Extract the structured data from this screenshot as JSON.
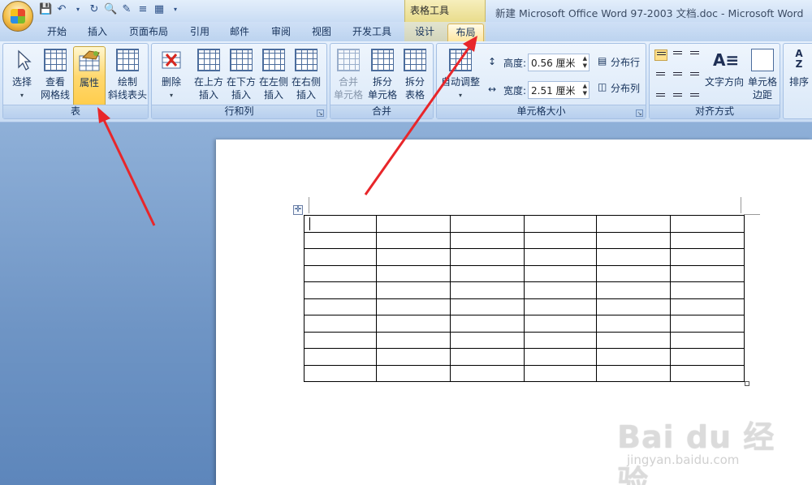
{
  "window": {
    "title": "新建 Microsoft Office Word 97-2003 文档.doc - Microsoft Word",
    "context_group": "表格工具"
  },
  "tabs": [
    {
      "label": "开始"
    },
    {
      "label": "插入"
    },
    {
      "label": "页面布局"
    },
    {
      "label": "引用"
    },
    {
      "label": "邮件"
    },
    {
      "label": "审阅"
    },
    {
      "label": "视图"
    },
    {
      "label": "开发工具"
    },
    {
      "label": "设计"
    },
    {
      "label": "布局",
      "active": true
    }
  ],
  "ribbon": {
    "groups": {
      "table": {
        "label": "表",
        "select": "选择",
        "view_gridlines_1": "查看",
        "view_gridlines_2": "网格线",
        "properties": "属性",
        "draw_diag_1": "绘制",
        "draw_diag_2": "斜线表头"
      },
      "rows_cols": {
        "label": "行和列",
        "delete": "删除",
        "above_1": "在上方",
        "above_2": "插入",
        "below_1": "在下方",
        "below_2": "插入",
        "left_1": "在左侧",
        "left_2": "插入",
        "right_1": "在右侧",
        "right_2": "插入"
      },
      "merge": {
        "label": "合并",
        "merge_1": "合并",
        "merge_2": "单元格",
        "split_1": "拆分",
        "split_2": "单元格",
        "split_table_1": "拆分",
        "split_table_2": "表格"
      },
      "cell_size": {
        "label": "单元格大小",
        "autofit": "自动调整",
        "height_label": "高度:",
        "height_value": "0.56 厘米",
        "width_label": "宽度:",
        "width_value": "2.51 厘米",
        "distribute_rows": "分布行",
        "distribute_cols": "分布列"
      },
      "alignment": {
        "label": "对齐方式",
        "text_dir": "文字方向",
        "margins_1": "单元格",
        "margins_2": "边距"
      },
      "data": {
        "sort": "排序"
      }
    }
  },
  "document": {
    "table": {
      "rows": 10,
      "cols": 6
    }
  },
  "watermark": {
    "logo": "Bai du 经验",
    "url": "jingyan.baidu.com"
  },
  "colors": {
    "annotation_arrow": "#e8262a",
    "highlight": "#ffd86e"
  }
}
